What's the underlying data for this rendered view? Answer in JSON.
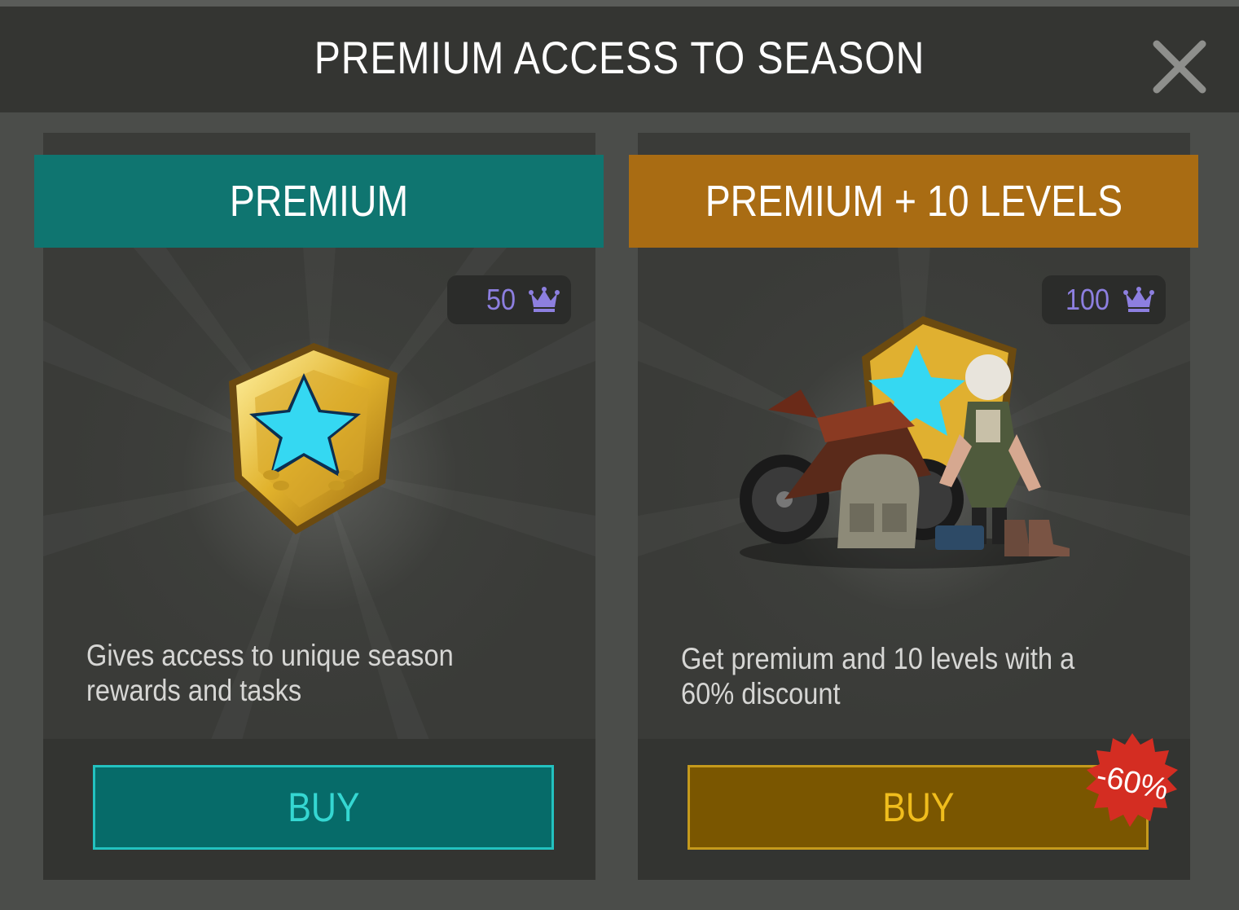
{
  "header": {
    "title": "PREMIUM ACCESS TO SEASON",
    "close_icon": "close-icon"
  },
  "offers": [
    {
      "banner_label": "PREMIUM",
      "price": "50",
      "currency_icon": "crown-icon",
      "reward_image": "star-shield-badge",
      "description": "Gives access to unique season\nrewards and tasks",
      "buy_label": "BUY",
      "accent": "#0f7570"
    },
    {
      "banner_label": "PREMIUM + 10 LEVELS",
      "price": "100",
      "currency_icon": "crown-icon",
      "reward_image": "motorcycle-character-bundle",
      "description": "Get premium and 10 levels with a\n60% discount",
      "buy_label": "BUY",
      "discount_badge": "-60%",
      "accent": "#a96c13"
    }
  ]
}
